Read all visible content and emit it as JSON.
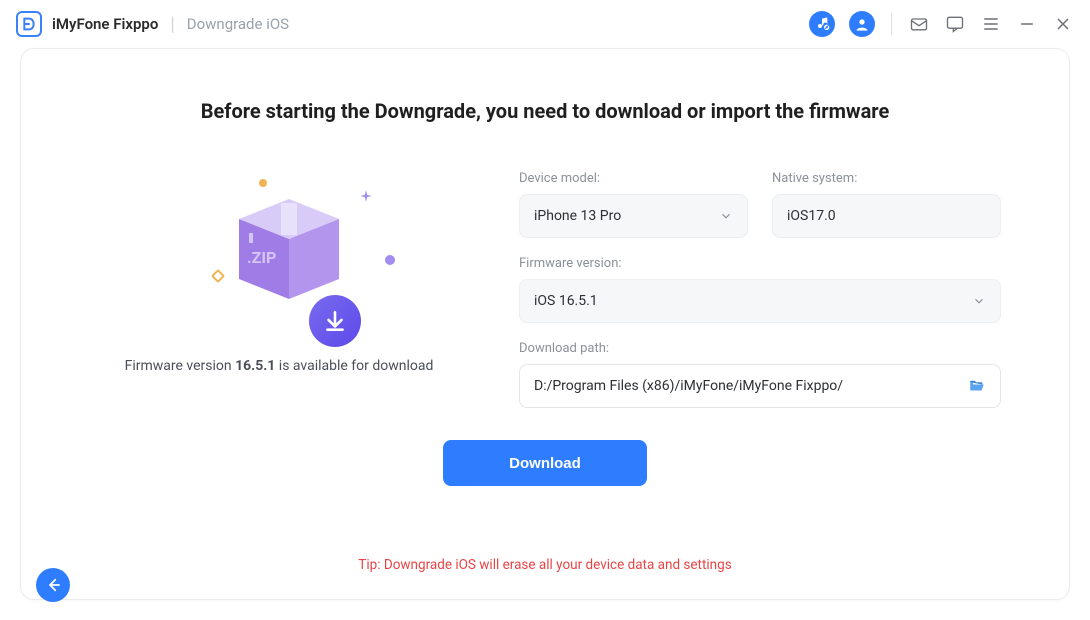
{
  "titlebar": {
    "app_name": "iMyFone Fixppo",
    "section": "Downgrade iOS"
  },
  "page": {
    "heading": "Before starting the Downgrade, you need to download or import the firmware",
    "availability_prefix": "Firmware version ",
    "availability_version": "16.5.1",
    "availability_suffix": " is available for download",
    "tip": "Tip: Downgrade iOS will erase all your device data and settings"
  },
  "form": {
    "device_model_label": "Device model:",
    "device_model_value": "iPhone 13 Pro",
    "native_system_label": "Native system:",
    "native_system_value": "iOS17.0",
    "firmware_version_label": "Firmware version:",
    "firmware_version_value": "iOS 16.5.1",
    "download_path_label": "Download path:",
    "download_path_value": "D:/Program Files (x86)/iMyFone/iMyFone Fixppo/"
  },
  "actions": {
    "download": "Download"
  },
  "illustration": {
    "zip_label": ".ZIP"
  }
}
